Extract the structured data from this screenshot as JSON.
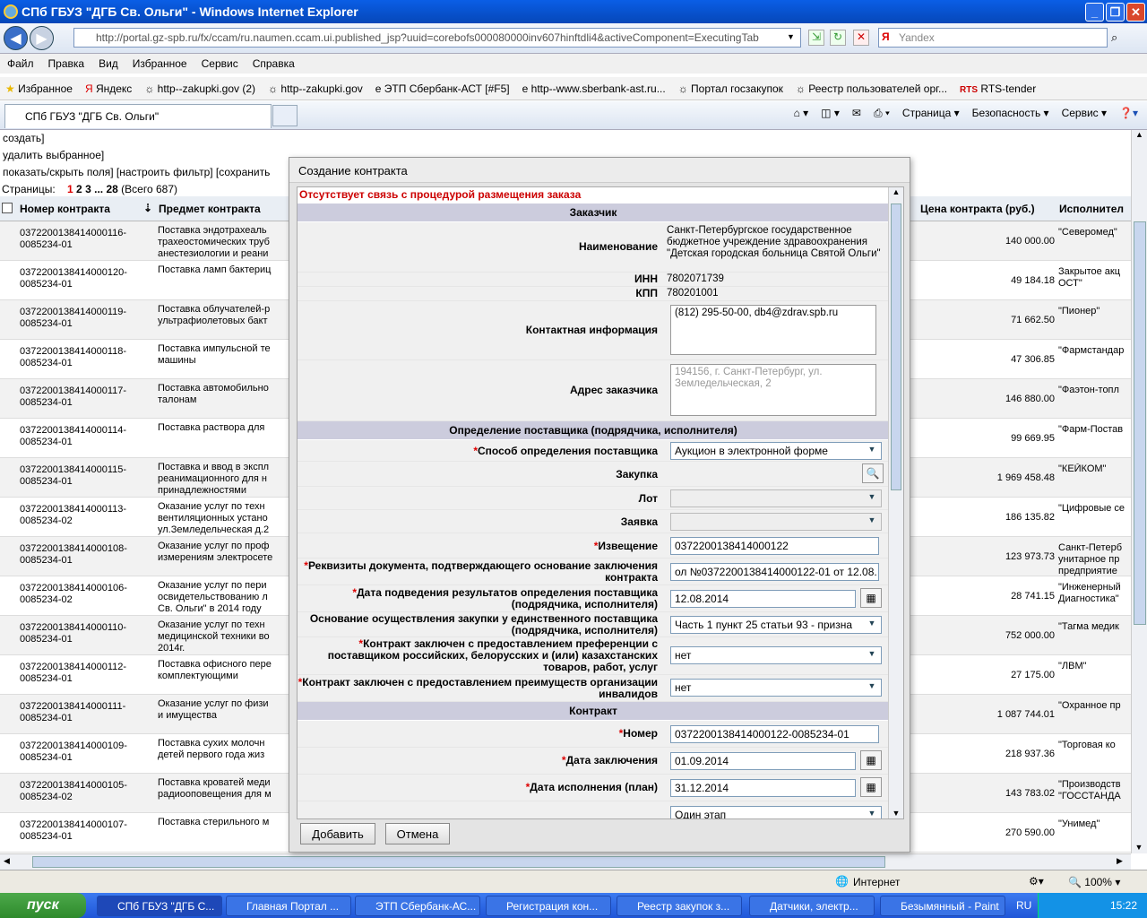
{
  "window": {
    "title": "СПб ГБУЗ \"ДГБ Св. Ольги\" - Windows Internet Explorer"
  },
  "address": {
    "url": "http://portal.gz-spb.ru/fx/ccam/ru.naumen.ccam.ui.published_jsp?uuid=corebofs000080000inv607hinftdli4&activeComponent=ExecutingTab",
    "search_placeholder": "Yandex"
  },
  "menu": [
    "Файл",
    "Правка",
    "Вид",
    "Избранное",
    "Сервис",
    "Справка"
  ],
  "favorites": {
    "label": "Избранное",
    "items": [
      "Яндекс",
      "http--zakupki.gov (2)",
      "http--zakupki.gov",
      "ЭТП Сбербанк-АСТ [#F5]",
      "http--www.sberbank-ast.ru...",
      "Портал госзакупок",
      "Реестр пользователей орг...",
      "RTS-tender"
    ]
  },
  "tab": {
    "label": "СПб ГБУЗ \"ДГБ Св. Ольги\""
  },
  "commands": [
    "Страница",
    "Безопасность",
    "Сервис"
  ],
  "page": {
    "link_create": "создать]",
    "link_delete": "удалить выбранное]",
    "link_fields": "показать/скрыть поля] [настроить фильтр] [сохранить",
    "pager_label": "Страницы:",
    "pager_cur": "1",
    "pager_p2": "2",
    "pager_p3": "3",
    "pager_dots": "...",
    "pager_last": "28",
    "pager_total": "(Всего 687)"
  },
  "grid": {
    "headers": {
      "number": "Номер контракта",
      "subject": "Предмет контракта",
      "price": "Цена контракта (руб.)",
      "executor": "Исполнител"
    },
    "rows": [
      {
        "num": "0372200138414000116-0085234-01",
        "subj": "Поставка эндотрахеаль\nтрахеостомических труб\nанестезиологии и реани",
        "price": "140 000.00",
        "exec": "\"Северомед\""
      },
      {
        "num": "0372200138414000120-0085234-01",
        "subj": "Поставка ламп бактериц",
        "price": "49 184.18",
        "exec": "Закрытое акц\nОСТ\""
      },
      {
        "num": "0372200138414000119-0085234-01",
        "subj": "Поставка облучателей-р\nультрафиолетовых бакт",
        "price": "71 662.50",
        "exec": "\"Пионер\""
      },
      {
        "num": "0372200138414000118-0085234-01",
        "subj": "Поставка импульсной те\nмашины",
        "price": "47 306.85",
        "exec": "\"Фармстандар"
      },
      {
        "num": "0372200138414000117-0085234-01",
        "subj": "Поставка автомобильно\nталонам",
        "price": "146 880.00",
        "exec": "\"Фаэтон-топл"
      },
      {
        "num": "0372200138414000114-0085234-01",
        "subj": "Поставка раствора для",
        "price": "99 669.95",
        "exec": "\"Фарм-Постав"
      },
      {
        "num": "0372200138414000115-0085234-01",
        "subj": "Поставка и ввод в экспл\nреанимационного для н\nпринадлежностями",
        "price": "1 969 458.48",
        "exec": "\"КЕЙКОМ\""
      },
      {
        "num": "0372200138414000113-0085234-02",
        "subj": "Оказание услуг по техн\nвентиляционных устано\nул.Земледельческая д.2",
        "price": "186 135.82",
        "exec": "\"Цифровые се"
      },
      {
        "num": "0372200138414000108-0085234-01",
        "subj": "Оказание услуг по проф\nизмерениям электросете",
        "price": "123 973.73",
        "exec": "Санкт-Петерб\nунитарное пр\nпредприятие"
      },
      {
        "num": "0372200138414000106-0085234-02",
        "subj": "Оказание услуг по пери\nосвидетельствованию л\nСв. Ольги\" в 2014 году",
        "price": "28 741.15",
        "exec": "\"Инженерный\nДиагностика\""
      },
      {
        "num": "0372200138414000110-0085234-01",
        "subj": "Оказание услуг по техн\nмедицинской техники во\n2014г.",
        "price": "752 000.00",
        "exec": "\"Тагма медик"
      },
      {
        "num": "0372200138414000112-0085234-01",
        "subj": "Поставка офисного пере\nкомплектующими",
        "price": "27 175.00",
        "exec": "\"ЛВМ\""
      },
      {
        "num": "0372200138414000111-0085234-01",
        "subj": "Оказание услуг по физи\nи имущества",
        "price": "1 087 744.01",
        "exec": "\"Охранное пр"
      },
      {
        "num": "0372200138414000109-0085234-01",
        "subj": "Поставка сухих молочн\nдетей первого года жиз",
        "price": "218 937.36",
        "exec": "\"Торговая ко"
      },
      {
        "num": "0372200138414000105-0085234-02",
        "subj": "Поставка кроватей меди\nрадиооповещения для м",
        "price": "143 783.02",
        "exec": "\"Производств\n\"ГОССТАНДА"
      },
      {
        "num": "0372200138414000107-0085234-01",
        "subj": "Поставка стерильного м",
        "price": "270 590.00",
        "exec": "\"Унимед\""
      }
    ]
  },
  "dialog": {
    "title": "Создание контракта",
    "warning": "Отсутствует связь с процедурой размещения заказа",
    "sect_customer": "Заказчик",
    "sect_supplier": "Определение поставщика (подрядчика, исполнителя)",
    "sect_contract": "Контракт",
    "lbl_name": "Наименование",
    "val_name": "Санкт-Петербургское государственное бюджетное учреждение здравоохранения \"Детская городская больница Святой Ольги\"",
    "lbl_inn": "ИНН",
    "val_inn": "7802071739",
    "lbl_kpp": "КПП",
    "val_kpp": "780201001",
    "lbl_contact": "Контактная информация",
    "val_contact": "(812) 295-50-00, db4@zdrav.spb.ru",
    "lbl_address": "Адрес заказчика",
    "val_address": "194156, г. Санкт-Петербург, ул. Земледельческая, 2",
    "lbl_method": "Способ определения поставщика",
    "val_method": "Аукцион в электронной форме",
    "lbl_purchase": "Закупка",
    "lbl_lot": "Лот",
    "lbl_bid": "Заявка",
    "lbl_notice": "Извещение",
    "val_notice": "0372200138414000122",
    "lbl_doc": "Реквизиты документа, подтверждающего основание заключения контракта",
    "val_doc": "ол №0372200138414000122-01 от 12.08.",
    "lbl_date_result": "Дата подведения результатов определения поставщика (подрядчика, исполнителя)",
    "val_date_result": "12.08.2014",
    "lbl_basis": "Основание осуществления закупки у единственного поставщика (подрядчика, исполнителя)",
    "val_basis": "Часть 1 пункт 25 статьи 93 -  призна",
    "lbl_pref": "Контракт заключен с предоставлением преференции с поставщиком российских, белорусских и (или) казахстанских товаров, работ, услуг",
    "val_pref": "нет",
    "lbl_inv": "Контракт заключен с предоставлением преимуществ организации инвалидов",
    "val_inv": "нет",
    "lbl_number": "Номер",
    "val_number": "0372200138414000122-0085234-01",
    "lbl_date_sign": "Дата заключения",
    "val_date_sign": "01.09.2014",
    "lbl_date_exec": "Дата исполнения (план)",
    "val_date_exec": "31.12.2014",
    "val_stage": "Один этап",
    "btn_add": "Добавить",
    "btn_cancel": "Отмена"
  },
  "status": {
    "zone": "Интернет",
    "zoom": "100%"
  },
  "taskbar": {
    "start": "пуск",
    "tasks": [
      "СПб ГБУЗ \"ДГБ С...",
      "Главная Портал ...",
      "ЭТП Сбербанк-АС...",
      "Регистрация кон...",
      "Реестр закупок з...",
      "Датчики, электр...",
      "Безымянный - Paint"
    ],
    "lang": "RU",
    "time": "15:22"
  }
}
